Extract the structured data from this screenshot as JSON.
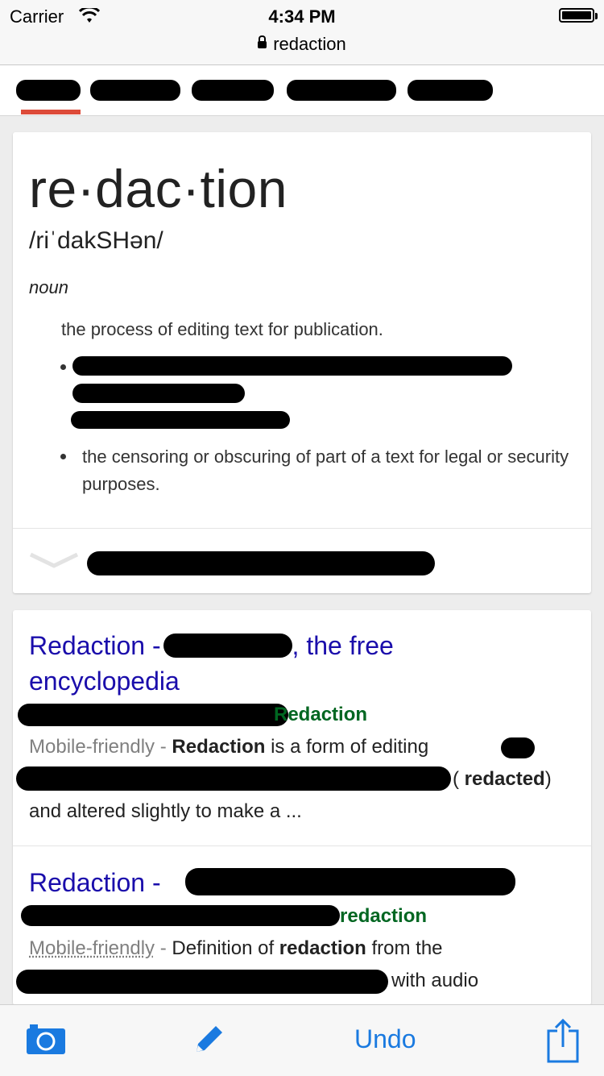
{
  "status_bar": {
    "carrier": "Carrier",
    "time": "4:34 PM",
    "url": "redaction"
  },
  "definition": {
    "word": "re·dac·tion",
    "pronunciation": "/riˈdakSHən/",
    "part_of_speech": "noun",
    "sense_1": "the process of editing text for publication.",
    "sense_2": "the censoring or obscuring of part of a text for legal or security purposes."
  },
  "results": [
    {
      "title_a": "Redaction - ",
      "title_b": ", the free",
      "title_c": "encyclopedia",
      "url_tail": "Redaction",
      "mobile": "Mobile-friendly - ",
      "snip_bold": "Redaction",
      "snip_1": " is a form of editing",
      "snip_2a": "( ",
      "snip_2b": "redacted",
      "snip_2c": ")",
      "snip_3": "and altered slightly to make a ..."
    },
    {
      "title_a": "Redaction - ",
      "url_tail": "redaction",
      "mobile": "Mobile-friendly",
      "dash": " - ",
      "snip_1": "Definition of ",
      "snip_bold": "redaction",
      "snip_2": " from the",
      "snip_3": "with audio"
    }
  ],
  "toolbar": {
    "undo": "Undo"
  },
  "colors": {
    "accent": "#dd4b39",
    "link": "#1a0dab",
    "url_green": "#006621",
    "ios_blue": "#1a7ae0"
  }
}
